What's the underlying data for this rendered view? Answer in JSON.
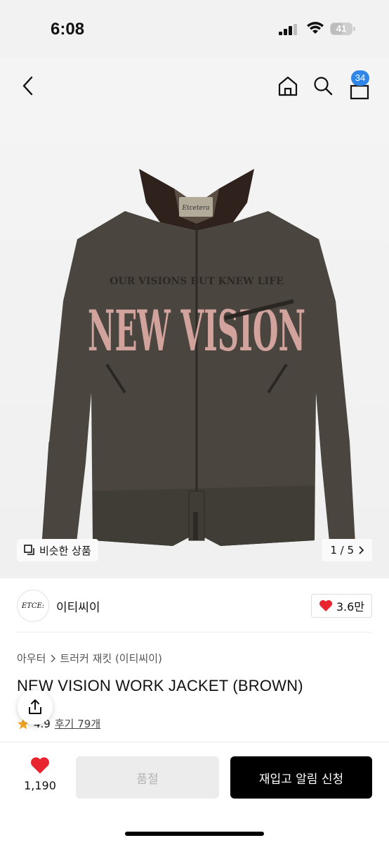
{
  "status": {
    "time": "6:08",
    "battery": "41"
  },
  "nav": {
    "cart_count": "34"
  },
  "hero": {
    "similar_label": "비슷한 상품",
    "pager": "1 / 5",
    "jacket": {
      "collar_tag": "Etcetera",
      "print_top": "OUR VISIONS  BUT KNEW LIFE",
      "print_main": "NEW VISION"
    }
  },
  "brand": {
    "logo_text": "ETCE:",
    "name": "이티씨이",
    "likes": "3.6만"
  },
  "breadcrumb": [
    "아우터",
    "트러커 재킷 (이티씨이)"
  ],
  "product": {
    "title": "NEW VISION WORK JACKET (BROWN)",
    "rating": "4.9",
    "reviews": "후기 79개"
  },
  "bottom": {
    "wish_count": "1,190",
    "soldout_label": "품절",
    "restock_label": "재입고 알림 신청"
  },
  "colors": {
    "accent_blue": "#2f86e8",
    "heart_red": "#e8242f",
    "jacket_brown": "#4a463f",
    "print_pink": "#d9a8a2"
  }
}
